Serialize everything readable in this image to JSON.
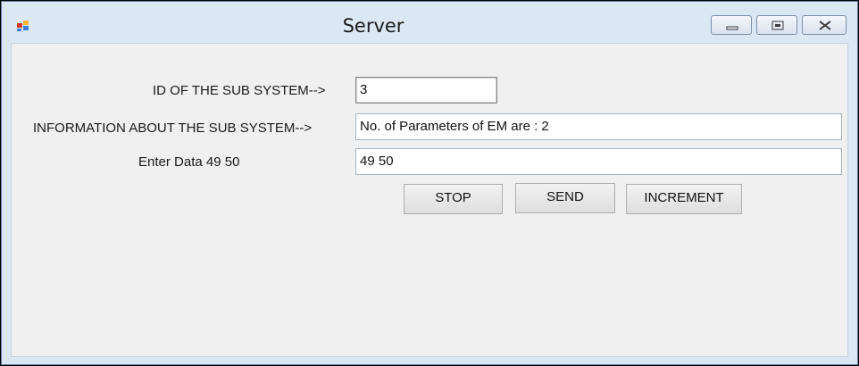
{
  "window": {
    "title": "Server"
  },
  "form": {
    "id_label": "ID OF THE SUB SYSTEM-->",
    "id_value": "3",
    "info_label": "INFORMATION ABOUT THE SUB SYSTEM-->",
    "info_value": "No. of Parameters of EM are : 2",
    "data_label": "Enter Data 49 50",
    "data_value": "49 50"
  },
  "buttons": {
    "stop_label": "STOP",
    "send_label": "SEND",
    "increment_label": "INCREMENT"
  },
  "icons": {
    "app": "app-window-icon",
    "minimize": "minimize-icon",
    "maximize": "maximize-icon",
    "close": "close-icon"
  },
  "colors": {
    "frame": "#dce7f4",
    "client": "#f0f0f0"
  }
}
